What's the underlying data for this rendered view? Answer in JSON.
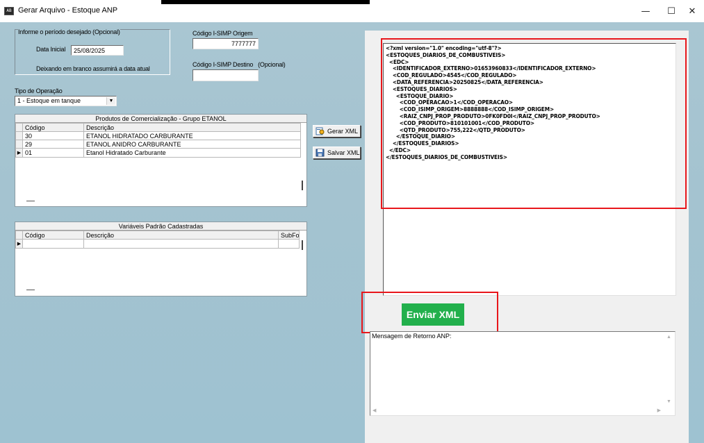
{
  "window": {
    "title": "Gerar Arquivo - Estoque ANP",
    "icon_text": "AB",
    "minimize": "—",
    "maximize": "☐",
    "close": "✕"
  },
  "period": {
    "group_label": "Informe o período desejado (Opcional)",
    "data_inicial_label": "Data Inicial",
    "data_inicial_value": "25/08/2025",
    "hint": "Deixando em branco assumirá a data atual"
  },
  "simp": {
    "origem_label": "Código I-SIMP Origem",
    "origem_value": "7777777",
    "destino_label": "Código I-SIMP Destino",
    "destino_optional": "(Opcional)",
    "destino_value": ""
  },
  "operacao": {
    "label": "Tipo de Operação",
    "selected": "1 - Estoque em tanque"
  },
  "produtos": {
    "caption": "Produtos de Comercialização - Grupo ETANOL",
    "columns": [
      "Código",
      "Descrição"
    ],
    "rows": [
      {
        "codigo": "30",
        "descricao": "ETANOL HIDRATADO CARBURANTE"
      },
      {
        "codigo": "29",
        "descricao": "ETANOL ANIDRO CARBURANTE"
      },
      {
        "codigo": "01",
        "descricao": "Etanol Hidratado Carburante"
      }
    ]
  },
  "variaveis": {
    "caption": "Variáveis Padrão Cadastradas",
    "columns": [
      "Código",
      "Descrição",
      "SubFo"
    ]
  },
  "buttons": {
    "gerar_xml": "Gerar XML",
    "salvar_xml": "Salvar XML",
    "enviar_xml": "Enviar XML"
  },
  "xml_text": "<?xml version=\"1.0\" encoding=\"utf-8\"?>\n<ESTOQUES_DIARIOS_DE_COMBUSTIVEIS>\n  <EDC>\n    <IDENTIFICADOR_EXTERNO>01653960833</IDENTIFICADOR_EXTERNO>\n    <COD_REGULADO>4545</COD_REGULADO>\n    <DATA_REFERENCIA>20250825</DATA_REFERENCIA>\n    <ESTOQUES_DIARIOS>\n      <ESTOQUE_DIARIO>\n        <COD_OPERACAO>1</COD_OPERACAO>\n        <COD_ISIMP_ORIGEM>8888888</COD_ISIMP_ORIGEM>\n        <RAIZ_CNPJ_PROP_PRODUTO>0FK0FD0I</RAIZ_CNPJ_PROP_PRODUTO>\n        <COD_PRODUTO>810101001</COD_PRODUTO>\n        <QTD_PRODUTO>755,222</QTD_PRODUTO>\n      </ESTOQUE_DIARIO>\n    </ESTOQUES_DIARIOS>\n  </EDC>\n</ESTOQUES_DIARIOS_DE_COMBUSTIVEIS>",
  "retorno": {
    "label": "Mensagem de Retorno ANP:"
  },
  "colors": {
    "background": "#a4c3d0",
    "enviar_button": "#22b04c",
    "highlight_box": "#e8161b"
  }
}
